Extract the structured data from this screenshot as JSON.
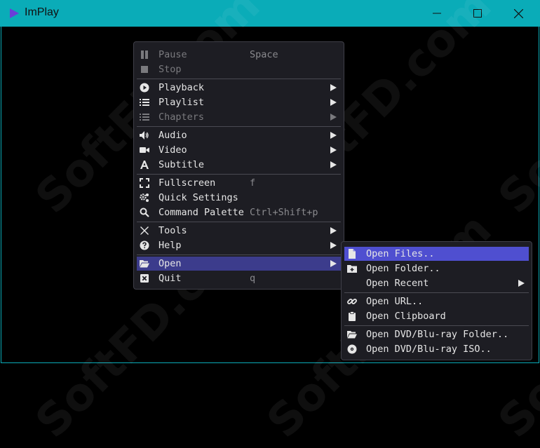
{
  "window": {
    "title": "ImPlay"
  },
  "watermark": "SoftFD.com",
  "colors": {
    "titlebar": "#0aacb8",
    "menu_bg": "#1d1d23",
    "highlight": "#3c3c8c",
    "sub_highlight": "#4f4fd0"
  },
  "main_menu": {
    "pause": {
      "label": "Pause",
      "shortcut": "Space",
      "icon": "pause-icon"
    },
    "stop": {
      "label": "Stop",
      "icon": "stop-icon"
    },
    "playback": {
      "label": "Playback",
      "icon": "play-circle-icon"
    },
    "playlist": {
      "label": "Playlist",
      "icon": "list-icon"
    },
    "chapters": {
      "label": "Chapters",
      "icon": "list-icon"
    },
    "audio": {
      "label": "Audio",
      "icon": "volume-icon"
    },
    "video": {
      "label": "Video",
      "icon": "video-camera-icon"
    },
    "subtitle": {
      "label": "Subtitle",
      "icon": "font-icon"
    },
    "fullscreen": {
      "label": "Fullscreen",
      "shortcut": "f",
      "icon": "expand-icon"
    },
    "quick_settings": {
      "label": "Quick Settings",
      "icon": "gears-icon"
    },
    "command_palette": {
      "label": "Command Palette",
      "shortcut": "Ctrl+Shift+p",
      "icon": "search-icon"
    },
    "tools": {
      "label": "Tools",
      "icon": "tools-icon"
    },
    "help": {
      "label": "Help",
      "icon": "question-circle-icon"
    },
    "open": {
      "label": "Open",
      "icon": "folder-open-icon"
    },
    "quit": {
      "label": "Quit",
      "shortcut": "q",
      "icon": "close-box-icon"
    }
  },
  "open_submenu": {
    "open_files": {
      "label": "Open Files..",
      "icon": "file-icon"
    },
    "open_folder": {
      "label": "Open Folder..",
      "icon": "folder-plus-icon"
    },
    "open_recent": {
      "label": "Open Recent"
    },
    "open_url": {
      "label": "Open URL..",
      "icon": "link-icon"
    },
    "open_clipboard": {
      "label": "Open Clipboard",
      "icon": "clipboard-icon"
    },
    "open_dvd_folder": {
      "label": "Open DVD/Blu-ray Folder..",
      "icon": "folder-open-icon"
    },
    "open_dvd_iso": {
      "label": "Open DVD/Blu-ray ISO..",
      "icon": "disc-icon"
    }
  }
}
